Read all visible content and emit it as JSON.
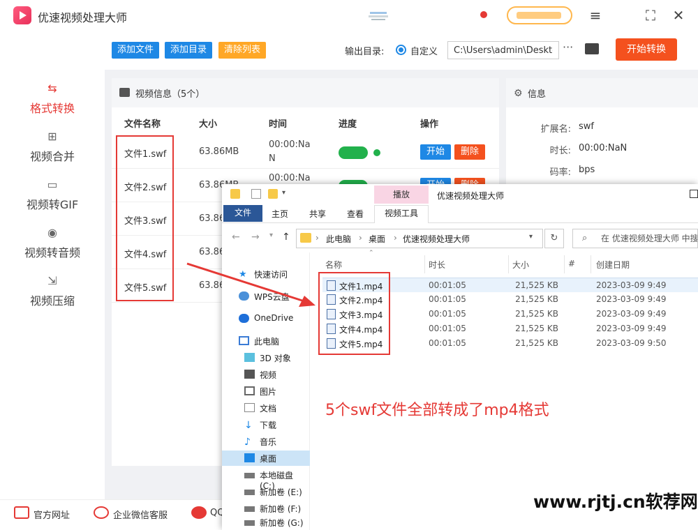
{
  "app": {
    "title": "优速视频处理大师"
  },
  "window_controls": [
    "≡",
    "⛶",
    "✕"
  ],
  "sidebar": {
    "items": [
      {
        "label": "格式转换",
        "icon": "convert-icon",
        "active": true
      },
      {
        "label": "视频合并",
        "icon": "merge-icon"
      },
      {
        "label": "视频转GIF",
        "icon": "gif-icon"
      },
      {
        "label": "视频转音频",
        "icon": "audio-icon"
      },
      {
        "label": "视频压缩",
        "icon": "compress-icon"
      }
    ]
  },
  "toolbar": {
    "add_file": "添加文件",
    "add_dir": "添加目录",
    "clear_list": "清除列表",
    "output_label": "输出目录:",
    "custom_label": "自定义",
    "output_path": "C:\\Users\\admin\\Deskto",
    "more": "···",
    "start_all": "开始转换"
  },
  "video_panel": {
    "title": "视频信息（5个）",
    "columns": [
      "文件名称",
      "大小",
      "时间",
      "进度",
      "操作"
    ],
    "rows": [
      {
        "name": "文件1.swf",
        "size": "63.86MB",
        "time": "00:00:Na N",
        "progress": 1.0
      },
      {
        "name": "文件2.swf",
        "size": "63.86MB",
        "time": "00:00:Na",
        "progress": 1.0
      },
      {
        "name": "文件3.swf",
        "size": "63.86",
        "time": "",
        "progress": 1.0
      },
      {
        "name": "文件4.swf",
        "size": "63.86",
        "time": "",
        "progress": 1.0
      },
      {
        "name": "文件5.swf",
        "size": "63.86",
        "time": "",
        "progress": 1.0
      }
    ],
    "start_label": "开始",
    "delete_label": "删除"
  },
  "info_panel": {
    "title": "信息",
    "fields": [
      {
        "key": "扩展名:",
        "value": "swf"
      },
      {
        "key": "时长:",
        "value": "00:00:NaN"
      },
      {
        "key": "码率:",
        "value": "bps"
      }
    ]
  },
  "footer": {
    "website": "官方网址",
    "wechat": "企业微信客服",
    "qq": "QQ"
  },
  "explorer": {
    "title": "优速视频处理大师",
    "context_tab": "播放",
    "ribbon_tabs": [
      "文件",
      "主页",
      "共享",
      "查看",
      "视频工具"
    ],
    "breadcrumb": [
      "此电脑",
      "桌面",
      "优速视频处理大师"
    ],
    "search_placeholder": "在 优速视频处理大师 中搜",
    "nav": [
      {
        "label": "快速访问",
        "icon": "star-icon"
      },
      {
        "label": "WPS云盘",
        "icon": "cloud-icon"
      },
      {
        "label": "OneDrive",
        "icon": "onedrive-icon"
      },
      {
        "label": "此电脑",
        "icon": "pc-icon"
      },
      {
        "label": "3D 对象",
        "icon": "cube-icon",
        "sub": true
      },
      {
        "label": "视频",
        "icon": "video-icon",
        "sub": true
      },
      {
        "label": "图片",
        "icon": "picture-icon",
        "sub": true
      },
      {
        "label": "文档",
        "icon": "document-icon",
        "sub": true
      },
      {
        "label": "下载",
        "icon": "download-icon",
        "sub": true
      },
      {
        "label": "音乐",
        "icon": "music-icon",
        "sub": true
      },
      {
        "label": "桌面",
        "icon": "desktop-icon",
        "sub": true,
        "selected": true
      },
      {
        "label": "本地磁盘 (C:)",
        "icon": "drive-icon",
        "sub": true
      },
      {
        "label": "新加卷 (E:)",
        "icon": "drive-icon",
        "sub": true
      },
      {
        "label": "新加卷 (F:)",
        "icon": "drive-icon",
        "sub": true
      },
      {
        "label": "新加卷 (G:)",
        "icon": "drive-icon",
        "sub": true
      }
    ],
    "columns": [
      "名称",
      "时长",
      "大小",
      "#",
      "创建日期"
    ],
    "files": [
      {
        "name": "文件1.mp4",
        "duration": "00:01:05",
        "size": "21,525 KB",
        "created": "2023-03-09 9:49"
      },
      {
        "name": "文件2.mp4",
        "duration": "00:01:05",
        "size": "21,525 KB",
        "created": "2023-03-09 9:49"
      },
      {
        "name": "文件3.mp4",
        "duration": "00:01:05",
        "size": "21,525 KB",
        "created": "2023-03-09 9:49"
      },
      {
        "name": "文件4.mp4",
        "duration": "00:01:05",
        "size": "21,525 KB",
        "created": "2023-03-09 9:49"
      },
      {
        "name": "文件5.mp4",
        "duration": "00:01:05",
        "size": "21,525 KB",
        "created": "2023-03-09 9:50"
      }
    ]
  },
  "annotation": "5个swf文件全部转成了mp4格式",
  "watermark": "www.rjtj.cn软荐网",
  "colors": {
    "accent": "#e53935",
    "blue": "#1e88e5",
    "orange": "#f4511e",
    "green": "#22b14c",
    "yellow": "#ffa726"
  }
}
